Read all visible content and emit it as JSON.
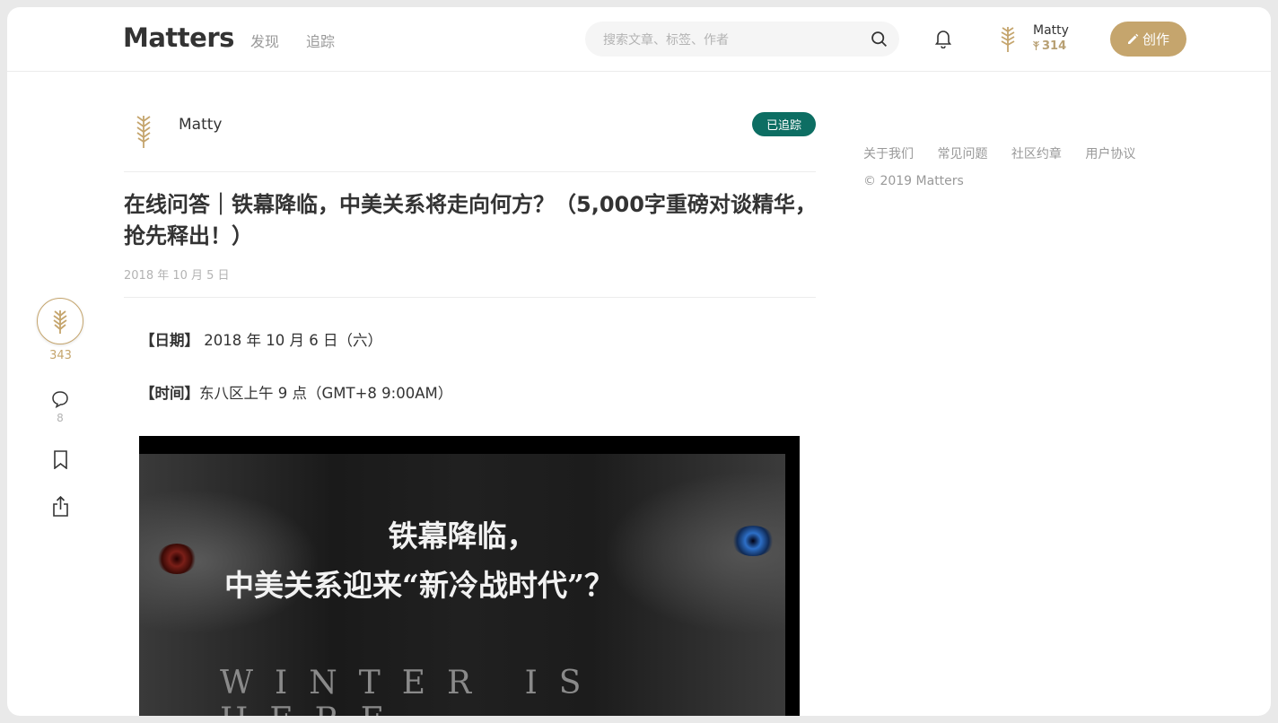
{
  "header": {
    "logo": "Matters",
    "nav": {
      "discover": "发现",
      "follow": "追踪"
    },
    "search_placeholder": "搜索文章、标签、作者",
    "user": {
      "name": "Matty",
      "score": "314"
    },
    "create_label": "创作"
  },
  "article": {
    "author": "Matty",
    "follow_status": "已追踪",
    "title": "在线问答｜铁幕降临，中美关系将走向何方？（5,000字重磅对谈精华，抢先释出！）",
    "date": "2018 年 10 月 5 日",
    "date_line": {
      "label": "【日期】",
      "value": " 2018 年 10 月 6 日（六）"
    },
    "time_line": {
      "label": "【时间】",
      "value": "东八区上午 9 点（GMT+8 9:00AM）"
    },
    "poster": {
      "line1": "铁幕降临，",
      "line2": "中美关系迎来“新冷战时代”？",
      "english": "WINTER IS HERE"
    }
  },
  "actions": {
    "claps": "343",
    "comments": "8"
  },
  "sidebar": {
    "links": [
      "关于我们",
      "常见问题",
      "社区约章",
      "用户协议"
    ],
    "copyright": "© 2019 Matters"
  },
  "colors": {
    "accent_gold": "#c5a56d",
    "follow_green": "#0d6e63",
    "muted_text": "#999999"
  }
}
